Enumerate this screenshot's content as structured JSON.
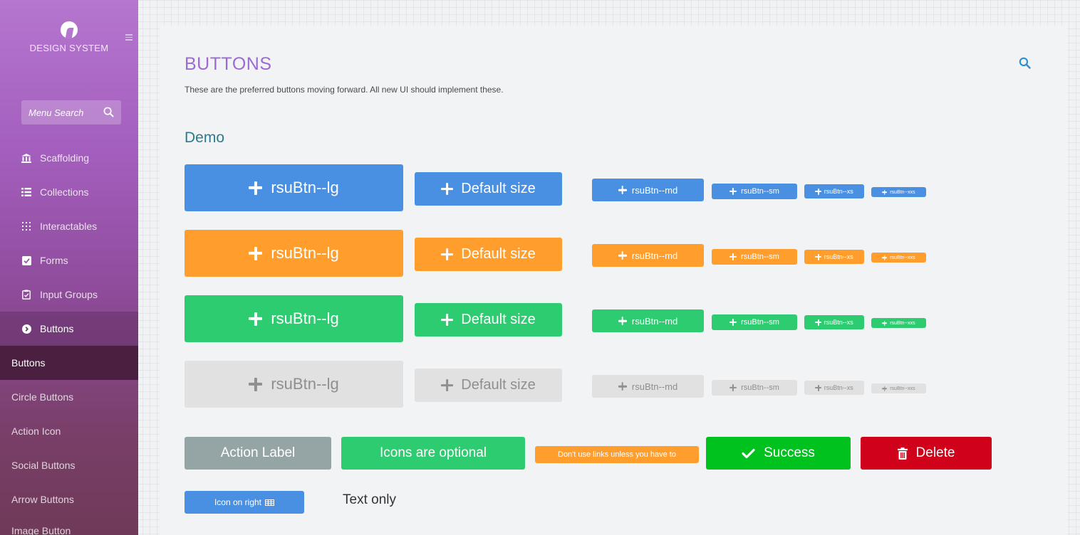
{
  "sidebar": {
    "logo_text": "DESIGN SYSTEM",
    "search_placeholder": "Menu Search",
    "items": [
      {
        "label": "Scaffolding",
        "icon": "building-icon"
      },
      {
        "label": "Collections",
        "icon": "list-icon"
      },
      {
        "label": "Interactables",
        "icon": "grid-dots-icon"
      },
      {
        "label": "Forms",
        "icon": "checkbox-icon"
      },
      {
        "label": "Input Groups",
        "icon": "clipboard-check-icon"
      },
      {
        "label": "Buttons",
        "icon": "chevron-circle-icon"
      }
    ],
    "sub_items": [
      {
        "label": "Buttons"
      },
      {
        "label": "Circle Buttons"
      },
      {
        "label": "Action Icon"
      },
      {
        "label": "Social Buttons"
      },
      {
        "label": "Arrow Buttons"
      },
      {
        "label": "Image Button"
      }
    ]
  },
  "main": {
    "title": "BUTTONS",
    "description": "These are the preferred buttons moving forward. All new UI should implement these.",
    "section_title": "Demo"
  },
  "demo_rows": [
    {
      "color": "#4a90e2",
      "lg": "rsuBtn--lg",
      "def": "Default size",
      "md": "rsuBtn--md",
      "sm": "rsuBtn--sm",
      "xs": "rsuBtn--xs",
      "xxs": "rsuBtn--xxs"
    },
    {
      "color": "#ff9e2c",
      "lg": "rsuBtn--lg",
      "def": "Default size",
      "md": "rsuBtn--md",
      "sm": "rsuBtn--sm",
      "xs": "rsuBtn--xs",
      "xxs": "rsuBtn--xxs"
    },
    {
      "color": "#2ecc71",
      "lg": "rsuBtn--lg",
      "def": "Default size",
      "md": "rsuBtn--md",
      "sm": "rsuBtn--sm",
      "xs": "rsuBtn--xs",
      "xxs": "rsuBtn--xxs"
    },
    {
      "color": "#e1e1e1",
      "lg": "rsuBtn--lg",
      "def": "Default size",
      "md": "rsuBtn--md",
      "sm": "rsuBtn--sm",
      "xs": "rsuBtn--xs",
      "xxs": "rsuBtn--xxs"
    }
  ],
  "extra_buttons": {
    "action_label": "Action Label",
    "icons_optional": "Icons are optional",
    "link_btn": "Don't use links unless you have to",
    "success": "Success",
    "delete": "Delete",
    "icon_on_right": "Icon on right",
    "text_only": "Text only"
  },
  "colors": {
    "sidebar_top": "#b476cf",
    "title": "#9b6bd3",
    "section": "#2a7b8e",
    "success": "#00c21e",
    "danger": "#d0021b",
    "neutral": "#95a5a6"
  }
}
